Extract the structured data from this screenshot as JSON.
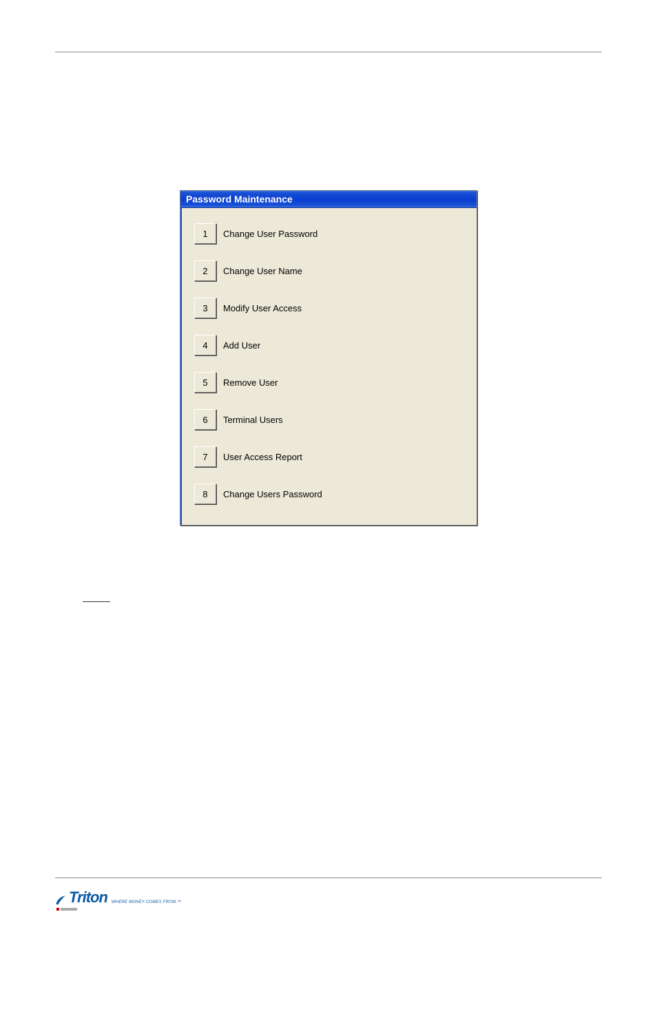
{
  "window": {
    "title": "Password Maintenance",
    "items": [
      {
        "num": "1",
        "label": "Change User Password"
      },
      {
        "num": "2",
        "label": "Change User Name"
      },
      {
        "num": "3",
        "label": "Modify User Access"
      },
      {
        "num": "4",
        "label": "Add User"
      },
      {
        "num": "5",
        "label": "Remove User"
      },
      {
        "num": "6",
        "label": "Terminal Users"
      },
      {
        "num": "7",
        "label": "User Access Report"
      },
      {
        "num": "8",
        "label": "Change Users Password"
      }
    ]
  },
  "logo": {
    "name": "Triton",
    "tagline": "WHERE MONEY COMES FROM.™"
  }
}
